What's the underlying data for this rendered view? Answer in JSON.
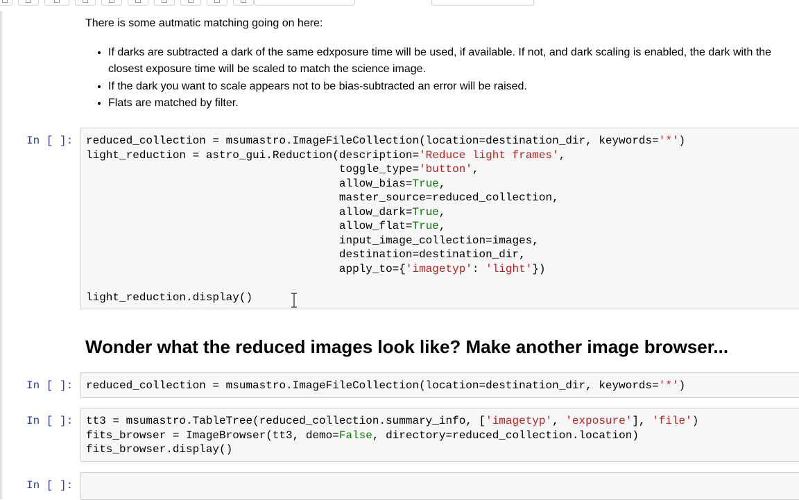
{
  "markdown": {
    "intro": "There is some autmatic matching going on here:",
    "bullets": [
      "If darks are subtracted a dark of the same edxposure time will be used, if available. If not, and dark scaling is enabled, the dark with the closest exposure time will be scaled to match the science image.",
      "If the dark you want to scale appears not to be bias-subtracted an error will be raised.",
      "Flats are matched by filter."
    ],
    "heading": "Wonder what the reduced images look like? Make another image browser..."
  },
  "cells": [
    {
      "prompt": "In [ ]:",
      "lines": [
        "reduced_collection = msumastro.ImageFileCollection(location=destination_dir, keywords='*')",
        "light_reduction = astro_gui.Reduction(description='Reduce light frames',",
        "                                      toggle_type='button',",
        "                                      allow_bias=True,",
        "                                      master_source=reduced_collection,",
        "                                      allow_dark=True,",
        "                                      allow_flat=True,",
        "                                      input_image_collection=images,",
        "                                      destination=destination_dir,",
        "                                      apply_to={'imagetyp': 'light'})",
        "",
        "light_reduction.display()"
      ]
    },
    {
      "prompt": "In [ ]:",
      "lines": [
        "reduced_collection = msumastro.ImageFileCollection(location=destination_dir, keywords='*')"
      ]
    },
    {
      "prompt": "In [ ]:",
      "lines": [
        "tt3 = msumastro.TableTree(reduced_collection.summary_info, ['imagetyp', 'exposure'], 'file')",
        "fits_browser = ImageBrowser(tt3, demo=False, directory=reduced_collection.location)",
        "fits_browser.display()"
      ]
    },
    {
      "prompt": "In [ ]:",
      "lines": [
        ""
      ]
    }
  ],
  "colors": {
    "prompt": "#303f9f",
    "string": "#ba2121",
    "keyword": "#008000",
    "cell_bg": "#f7f7f7",
    "cell_border": "#cfcfcf"
  },
  "icons": {
    "text_cursor": "i-beam-cursor-icon"
  }
}
